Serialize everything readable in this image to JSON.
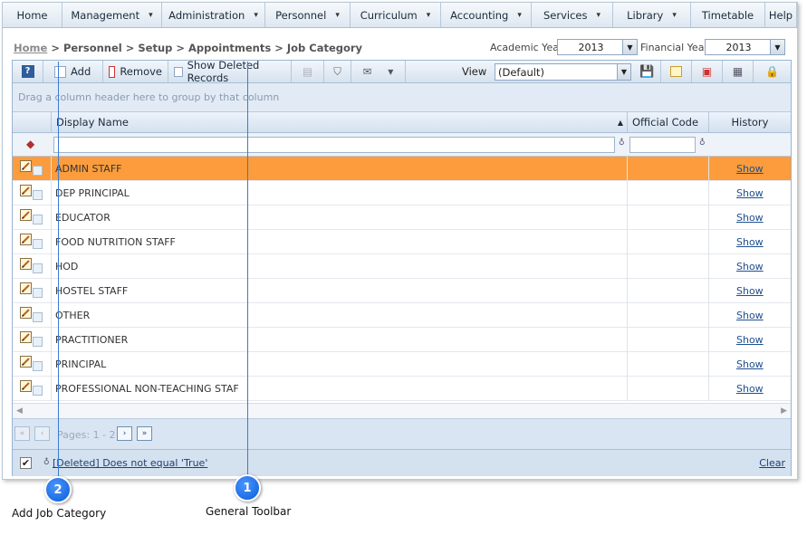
{
  "menu": [
    {
      "label": "Home",
      "has_dropdown": false
    },
    {
      "label": "Management",
      "has_dropdown": true
    },
    {
      "label": "Administration",
      "has_dropdown": true
    },
    {
      "label": "Personnel",
      "has_dropdown": true
    },
    {
      "label": "Curriculum",
      "has_dropdown": true
    },
    {
      "label": "Accounting",
      "has_dropdown": true
    },
    {
      "label": "Services",
      "has_dropdown": true
    },
    {
      "label": "Library",
      "has_dropdown": true
    },
    {
      "label": "Timetable",
      "has_dropdown": false
    },
    {
      "label": "Help",
      "has_dropdown": false
    }
  ],
  "breadcrumb": {
    "home": "Home",
    "path": " > Personnel > Setup > Appointments > Job Category"
  },
  "years": {
    "academic_label": "Academic Year",
    "academic_value": "2013",
    "financial_label": "Financial Year",
    "financial_value": "2013"
  },
  "toolbar": {
    "add_label": "Add",
    "remove_label": "Remove",
    "show_deleted_label": "Show Deleted Records",
    "view_label": "View",
    "view_value": "(Default)"
  },
  "grid": {
    "group_hint": "Drag a column header here to group by that column",
    "columns": [
      "Display Name",
      "Official Code",
      "History"
    ],
    "rows": [
      {
        "name": "ADMIN STAFF",
        "history": "Show",
        "selected": true
      },
      {
        "name": "DEP PRINCIPAL",
        "history": "Show",
        "selected": false
      },
      {
        "name": "EDUCATOR",
        "history": "Show",
        "selected": false
      },
      {
        "name": "FOOD NUTRITION STAFF",
        "history": "Show",
        "selected": false
      },
      {
        "name": "HOD",
        "history": "Show",
        "selected": false
      },
      {
        "name": "HOSTEL STAFF",
        "history": "Show",
        "selected": false
      },
      {
        "name": "OTHER",
        "history": "Show",
        "selected": false
      },
      {
        "name": "PRACTITIONER",
        "history": "Show",
        "selected": false
      },
      {
        "name": "PRINCIPAL",
        "history": "Show",
        "selected": false
      },
      {
        "name": "PROFESSIONAL NON-TEACHING STAF",
        "history": "Show",
        "selected": false
      }
    ],
    "pager_text": "Pages: 1 - 2",
    "filter_text": "[Deleted] Does not equal 'True'",
    "filter_checked": "✔",
    "clear_label": "Clear"
  },
  "callouts": {
    "general_toolbar": {
      "number": "1",
      "label": "General Toolbar"
    },
    "add_job_category": {
      "number": "2",
      "label": "Add Job Category"
    }
  },
  "colors": {
    "selected_row": "#fc9c3c",
    "callout_blue": "#0a5bd8",
    "link": "#1f4f8f"
  }
}
